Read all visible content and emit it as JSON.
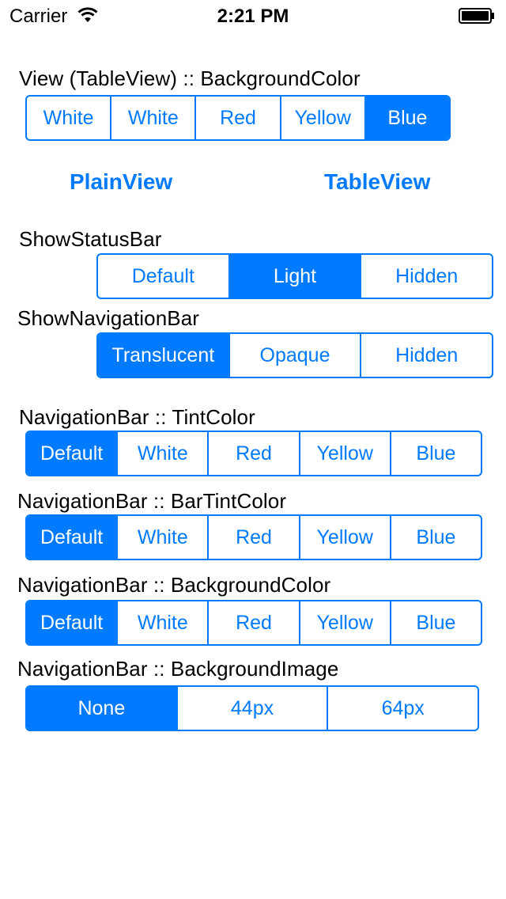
{
  "status_bar": {
    "carrier": "Carrier",
    "time": "2:21 PM"
  },
  "sections": {
    "view_bg": {
      "title": "View (TableView) :: BackgroundColor",
      "options": [
        "White",
        "White",
        "Red",
        "Yellow",
        "Blue"
      ],
      "selected": 4
    },
    "show_status_bar": {
      "title": "ShowStatusBar",
      "options": [
        "Default",
        "Light",
        "Hidden"
      ],
      "selected": 1
    },
    "show_navigation_bar": {
      "title": "ShowNavigationBar",
      "options": [
        "Translucent",
        "Opaque",
        "Hidden"
      ],
      "selected": 0
    },
    "nav_tint": {
      "title": "NavigationBar :: TintColor",
      "options": [
        "Default",
        "White",
        "Red",
        "Yellow",
        "Blue"
      ],
      "selected": 0
    },
    "nav_bar_tint": {
      "title": "NavigationBar :: BarTintColor",
      "options": [
        "Default",
        "White",
        "Red",
        "Yellow",
        "Blue"
      ],
      "selected": 0
    },
    "nav_bg_color": {
      "title": "NavigationBar :: BackgroundColor",
      "options": [
        "Default",
        "White",
        "Red",
        "Yellow",
        "Blue"
      ],
      "selected": 0
    },
    "nav_bg_image": {
      "title": "NavigationBar :: BackgroundImage",
      "options": [
        "None",
        "44px",
        "64px"
      ],
      "selected": 0
    }
  },
  "buttons": {
    "plain_view": "PlainView",
    "table_view": "TableView"
  },
  "colors": {
    "accent": "#007aff",
    "background": "#ffffff"
  },
  "icons": {
    "wifi": "wifi-icon",
    "battery": "battery-icon"
  }
}
